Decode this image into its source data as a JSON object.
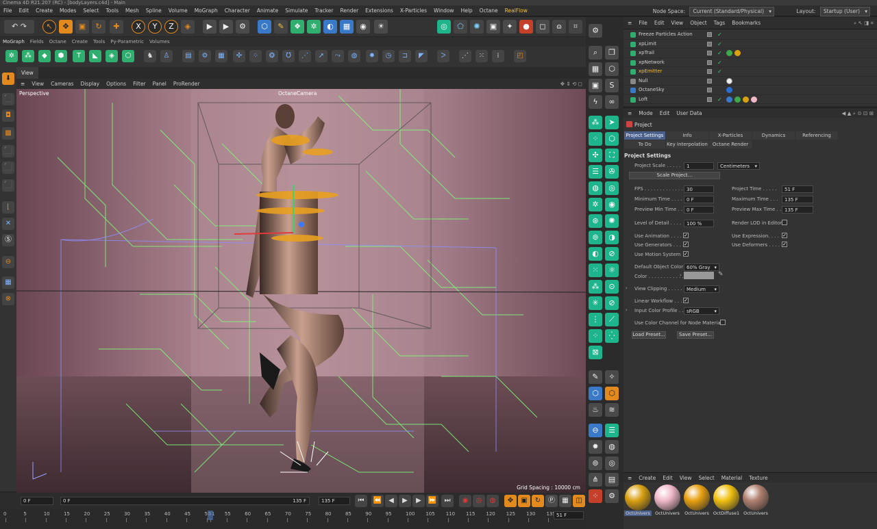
{
  "window": {
    "title": "Cinema 4D R21.207 (RC) - [bodyLayers.c4d] - Main"
  },
  "menubar": {
    "items": [
      "File",
      "Edit",
      "Create",
      "Modes",
      "Select",
      "Tools",
      "Mesh",
      "Spline",
      "Volume",
      "MoGraph",
      "Character",
      "Animate",
      "Simulate",
      "Tracker",
      "Render",
      "Extensions",
      "X-Particles",
      "Window",
      "Help",
      "Octane",
      "RealFlow"
    ],
    "node_space_label": "Node Space:",
    "node_space_value": "Current (Standard/Physical)",
    "layout_label": "Layout:",
    "layout_value": "Startup (User)"
  },
  "palette_tabs": [
    "MoGraph",
    "Fields",
    "Octane",
    "Create",
    "Tools",
    "Py-Parametric",
    "Volumes"
  ],
  "view": {
    "tab": "View",
    "menu": [
      "View",
      "Cameras",
      "Display",
      "Options",
      "Filter",
      "Panel",
      "ProRender"
    ],
    "projection": "Perspective",
    "camera": "OctaneCamera",
    "grid_spacing": "Grid Spacing : 10000 cm"
  },
  "timeline": {
    "current_frame": "0 F",
    "start_frame": "0 F",
    "end_frame": "135 F",
    "end_frame2": "135 F",
    "ruler": [
      "0",
      "5",
      "10",
      "15",
      "20",
      "25",
      "30",
      "35",
      "40",
      "45",
      "50",
      "51",
      "55",
      "60",
      "65",
      "70",
      "75",
      "80",
      "85",
      "90",
      "95",
      "100",
      "105",
      "110",
      "115",
      "120",
      "125",
      "130",
      "135"
    ],
    "ruler_end": "51 F",
    "playhead": 51
  },
  "object_manager": {
    "menu": [
      "File",
      "Edit",
      "View",
      "Object",
      "Tags",
      "Bookmarks"
    ],
    "objects": [
      {
        "name": "Freeze Particles Action",
        "color": "#2fae6f"
      },
      {
        "name": "xpLimit",
        "color": "#2fae6f"
      },
      {
        "name": "xpTrail",
        "color": "#2fae6f"
      },
      {
        "name": "xpNetwork",
        "color": "#2fae6f"
      },
      {
        "name": "xpEmitter",
        "color": "#2fae6f",
        "highlight": "#f0c040"
      },
      {
        "name": "Null",
        "color": "#888888"
      },
      {
        "name": "OctaneSky",
        "color": "#3a78c8"
      },
      {
        "name": "Loft",
        "color": "#2fae6f"
      }
    ]
  },
  "attributes": {
    "menu": [
      "Mode",
      "Edit",
      "User Data"
    ],
    "title": "Project",
    "tabs_row1": [
      "Project Settings",
      "Info",
      "X-Particles",
      "Dynamics",
      "Referencing"
    ],
    "tabs_row2": [
      "To Do",
      "Key Interpolation",
      "Octane Render"
    ],
    "section": "Project Settings",
    "project_scale_label": "Project Scale . . . . .",
    "project_scale_value": "1",
    "project_scale_unit": "Centimeters",
    "scale_project_button": "Scale Project...",
    "fps_label": "FPS . . . . . . . . . . . . . .",
    "fps_value": "30",
    "project_time_label": "Project Time . . . . .",
    "project_time_value": "51 F",
    "min_time_label": "Minimum Time . . . .",
    "min_time_value": "0 F",
    "max_time_label": "Maximum Time . . .",
    "max_time_value": "135 F",
    "preview_min_label": "Preview Min Time . .",
    "preview_min_value": "0 F",
    "preview_max_label": "Preview Max Time . .",
    "preview_max_value": "135 F",
    "lod_label": "Level of Detail . . . .",
    "lod_value": "100 %",
    "render_lod_label": "Render LOD in Editor",
    "use_animation_label": "Use Animation . . . . .",
    "use_expression_label": "Use Expression. . . .",
    "use_generators_label": "Use Generators . . . .",
    "use_deformers_label": "Use Deformers . . . .",
    "use_motion_label": "Use Motion System",
    "default_color_label": "Default Object Color",
    "default_color_value": "60% Gray",
    "color_label": "Color . . . . . . . . . . . .",
    "view_clipping_label": "View Clipping . . . . .",
    "view_clipping_value": "Medium",
    "linear_workflow_label": "Linear Workflow . . .",
    "input_color_label": "Input Color Profile . .",
    "input_color_value": "sRGB",
    "color_channel_label": "Use Color Channel for Node Material",
    "load_preset": "Load Preset...",
    "save_preset": "Save Preset..."
  },
  "materials": {
    "menu": [
      "Create",
      "Edit",
      "View",
      "Select",
      "Material",
      "Texture"
    ],
    "items": [
      {
        "name": "OctUnivers",
        "color": "#d9a010"
      },
      {
        "name": "OctUnivers",
        "color": "#f0b8c8"
      },
      {
        "name": "OctUnivers",
        "color": "#e8a010"
      },
      {
        "name": "OctDiffuse1",
        "color": "#f0c010"
      },
      {
        "name": "OctUnivers",
        "color": "#b08070"
      }
    ]
  }
}
